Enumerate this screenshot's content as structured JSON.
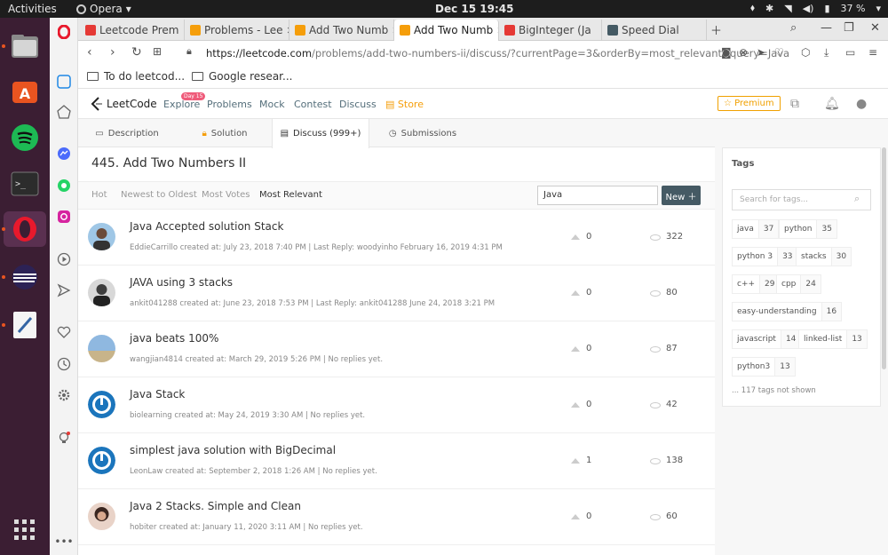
{
  "topbar": {
    "activities": "Activities",
    "app_name": "Opera",
    "clock": "Dec 15  19:45",
    "battery": "37 %"
  },
  "browser": {
    "tabs": [
      {
        "label": "Leetcode Prem",
        "color": "#e53935"
      },
      {
        "label": "Problems - Lee",
        "color": "#f59e0b"
      },
      {
        "label": "Add Two Numb",
        "color": "#f59e0b"
      },
      {
        "label": "Add Two Numb",
        "color": "#f59e0b",
        "active": true
      },
      {
        "label": "BigInteger (Ja",
        "color": "#e53935"
      },
      {
        "label": "Speed Dial",
        "color": "#455a64"
      }
    ],
    "url_host": "https://leetcode.com",
    "url_path": "/problems/add-two-numbers-ii/discuss/?currentPage=3&orderBy=most_relevant&query=Java",
    "bookmarks": [
      "To do leetcod...",
      "Google resear..."
    ]
  },
  "lc": {
    "logo": "LeetCode",
    "nav": [
      "Explore",
      "Problems",
      "Mock",
      "Contest",
      "Discuss",
      "Store"
    ],
    "day_badge": "Day 15",
    "premium": "☆ Premium",
    "tabs": [
      "Description",
      "Solution",
      "Discuss (999+)",
      "Submissions"
    ],
    "problem_title": "445. Add Two Numbers II",
    "sorts": [
      "Hot",
      "Newest to Oldest",
      "Most Votes",
      "Most Relevant"
    ],
    "search_value": "Java",
    "new_button": "New ＋",
    "posts": [
      {
        "title": "Java Accepted solution Stack",
        "meta": "EddieCarrillo created at: July 23, 2018 7:40 PM | Last Reply: woodyinho February 16, 2019 4:31 PM",
        "votes": "0",
        "views": "322"
      },
      {
        "title": "JAVA using 3 stacks",
        "meta": "ankit041288 created at: June 23, 2018 7:53 PM | Last Reply: ankit041288 June 24, 2018 3:21 PM",
        "votes": "0",
        "views": "80"
      },
      {
        "title": "java beats 100%",
        "meta": "wangjian4814 created at: March 29, 2019 5:26 PM | No replies yet.",
        "votes": "0",
        "views": "87"
      },
      {
        "title": "Java Stack",
        "meta": "biolearning created at: May 24, 2019 3:30 AM | No replies yet.",
        "votes": "0",
        "views": "42"
      },
      {
        "title": "simplest java solution with BigDecimal",
        "meta": "LeonLaw created at: September 2, 2018 1:26 AM | No replies yet.",
        "votes": "1",
        "views": "138"
      },
      {
        "title": "Java 2 Stacks. Simple and Clean",
        "meta": "hobiter created at: January 11, 2020 3:11 AM | No replies yet.",
        "votes": "0",
        "views": "60"
      }
    ],
    "tags_title": "Tags",
    "tags_placeholder": "Search for tags...",
    "tags": [
      {
        "name": "java",
        "count": "37"
      },
      {
        "name": "python",
        "count": "35"
      },
      {
        "name": "python 3",
        "count": "33"
      },
      {
        "name": "stacks",
        "count": "30"
      },
      {
        "name": "c++",
        "count": "29"
      },
      {
        "name": "cpp",
        "count": "24"
      },
      {
        "name": "easy-understanding",
        "count": "16"
      },
      {
        "name": "javascript",
        "count": "14"
      },
      {
        "name": "linked-list",
        "count": "13"
      },
      {
        "name": "python3",
        "count": "13"
      }
    ],
    "tags_more": "... 117 tags not shown"
  }
}
